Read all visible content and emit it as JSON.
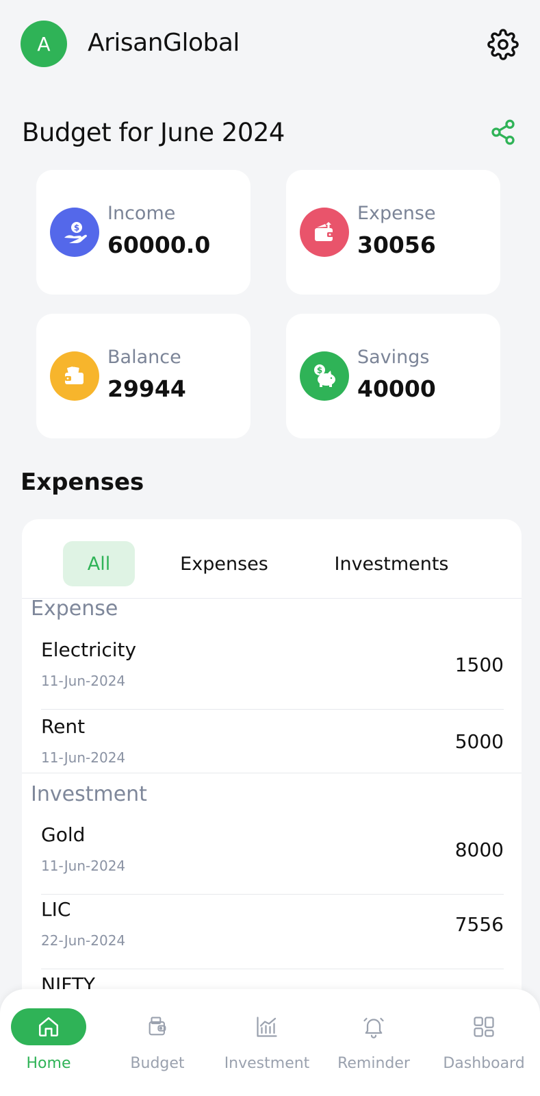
{
  "header": {
    "avatar_letter": "A",
    "app_name": "ArisanGlobal"
  },
  "budget": {
    "title": "Budget for June 2024"
  },
  "summary": [
    {
      "label": "Income",
      "value": "60000.0",
      "color": "#5468ea",
      "icon": "income-hand-dollar-icon"
    },
    {
      "label": "Expense",
      "value": "30056",
      "color": "#e9546b",
      "icon": "expense-wallet-icon"
    },
    {
      "label": "Balance",
      "value": "29944",
      "color": "#f7b52c",
      "icon": "balance-wallet-icon"
    },
    {
      "label": "Savings",
      "value": "40000",
      "color": "#2fb357",
      "icon": "savings-piggy-icon"
    }
  ],
  "expenses_section": {
    "title": "Expenses",
    "tabs": [
      "All",
      "Expenses",
      "Investments"
    ],
    "active_tab": "All",
    "groups": [
      {
        "title": "Expense",
        "items": [
          {
            "name": "Electricity",
            "date": "11-Jun-2024",
            "amount": "1500"
          },
          {
            "name": "Rent",
            "date": "11-Jun-2024",
            "amount": "5000"
          }
        ]
      },
      {
        "title": "Investment",
        "items": [
          {
            "name": "Gold",
            "date": "11-Jun-2024",
            "amount": "8000"
          },
          {
            "name": "LIC",
            "date": "22-Jun-2024",
            "amount": "7556"
          },
          {
            "name": "NIFTY",
            "date": "",
            "amount": ""
          }
        ]
      }
    ]
  },
  "nav": {
    "items": [
      "Home",
      "Budget",
      "Investment",
      "Reminder",
      "Dashboard"
    ],
    "active": "Home"
  },
  "colors": {
    "accent": "#2fb357",
    "background": "#f4f5f7",
    "muted_text": "#7e879a"
  }
}
